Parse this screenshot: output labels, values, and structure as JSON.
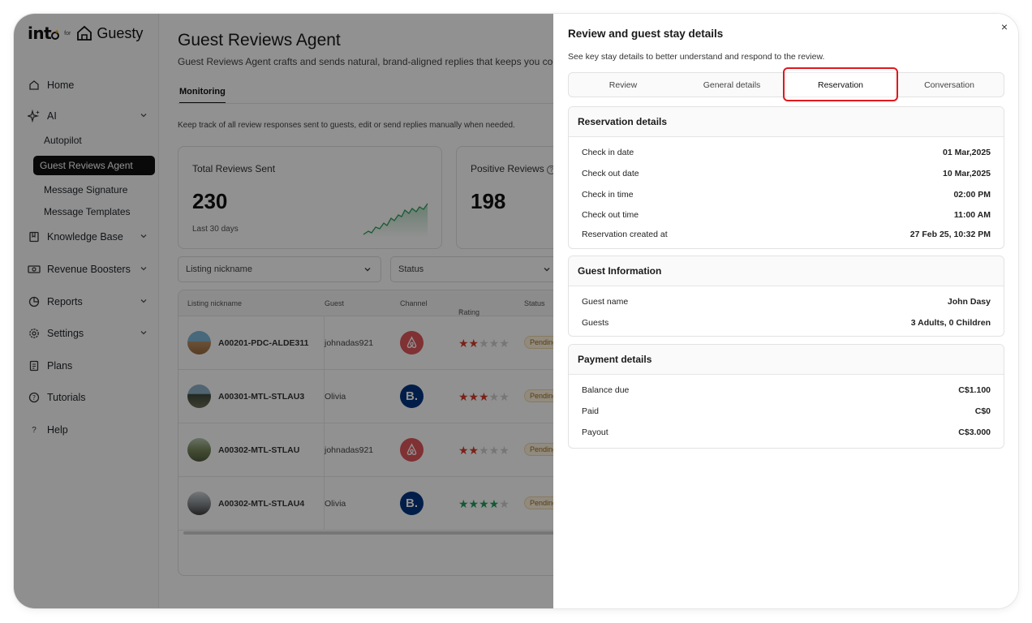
{
  "logo": {
    "brand": "int",
    "for": "for",
    "partner": "Guesty"
  },
  "nav": {
    "home": "Home",
    "ai": "AI",
    "autopilot": "Autopilot",
    "guest_reviews_agent": "Guest Reviews Agent",
    "message_signature": "Message Signature",
    "message_templates": "Message Templates",
    "knowledge_base": "Knowledge Base",
    "revenue_boosters": "Revenue Boosters",
    "reports": "Reports",
    "settings": "Settings",
    "plans": "Plans",
    "tutorials": "Tutorials",
    "help": "Help"
  },
  "main": {
    "title": "Guest Reviews Agent",
    "subtitle": "Guest Reviews Agent crafts and sends natural, brand-aligned replies that keeps you conn",
    "tab": "Monitoring",
    "description": "Keep track of all review responses sent to guests, edit or send replies manually when needed.",
    "cards": [
      {
        "label": "Total Reviews Sent",
        "value": "230",
        "foot": "Last 30 days"
      },
      {
        "label": "Positive Reviews",
        "value": "198"
      }
    ],
    "filters": {
      "listing": "Listing nickname",
      "status": "Status"
    },
    "table": {
      "headers": [
        "Listing nickname",
        "Guest",
        "Channel",
        "Rating",
        "Status"
      ],
      "rows": [
        {
          "listing": "A00201-PDC-ALDE311",
          "guest": "johnadas921",
          "channel": "airbnb",
          "rating": 2,
          "status": "Pending"
        },
        {
          "listing": "A00301-MTL-STLAU3",
          "guest": "Olivia",
          "channel": "booking",
          "rating": 3,
          "status": "Pending"
        },
        {
          "listing": "A00302-MTL-STLAU",
          "guest": "johnadas921",
          "channel": "airbnb",
          "rating": 2,
          "status": "Pending"
        },
        {
          "listing": "A00302-MTL-STLAU4",
          "guest": "Olivia",
          "channel": "booking",
          "rating": 4,
          "status": "Pending"
        }
      ]
    }
  },
  "drawer": {
    "title": "Review and guest stay details",
    "close": "×",
    "subtitle": "See key stay details to better understand and respond to the review.",
    "tabs": [
      "Review",
      "General details",
      "Reservation",
      "Conversation"
    ],
    "active_tab": "Reservation",
    "reservation": {
      "heading": "Reservation details",
      "rows": [
        {
          "k": "Check in date",
          "v": "01 Mar,2025"
        },
        {
          "k": "Check out date",
          "v": "10 Mar,2025"
        },
        {
          "k": "Check in time",
          "v": "02:00 PM"
        },
        {
          "k": "Check out time",
          "v": "11:00 AM"
        },
        {
          "k": "Reservation created at",
          "v": "27 Feb 25, 10:32 PM"
        }
      ]
    },
    "guest": {
      "heading": "Guest Information",
      "rows": [
        {
          "k": "Guest name",
          "v": "John Dasy"
        },
        {
          "k": "Guests",
          "v": "3 Adults, 0 Children"
        }
      ]
    },
    "payment": {
      "heading": "Payment details",
      "rows": [
        {
          "k": "Balance due",
          "v": "C$1.100"
        },
        {
          "k": "Paid",
          "v": "C$0"
        },
        {
          "k": "Payout",
          "v": "C$3.000"
        }
      ]
    }
  },
  "colors": {
    "accent_dark": "#111111",
    "highlight": "#e0181f",
    "airbnb": "#e0565b",
    "booking": "#003580",
    "star_red": "#d93a2b",
    "star_green": "#1e9e5a"
  }
}
